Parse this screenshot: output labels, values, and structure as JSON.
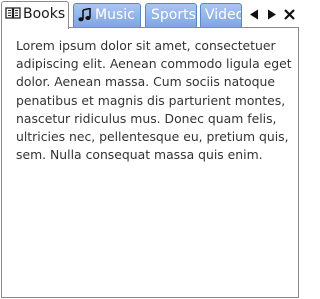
{
  "tabs": [
    {
      "label": "Books",
      "icon": "book-icon",
      "active": true
    },
    {
      "label": "Music",
      "icon": "music-note-icon",
      "active": false
    },
    {
      "label": "Sports",
      "active": false
    },
    {
      "label": "Video",
      "active": false
    }
  ],
  "nav": {
    "prev_icon": "triangle-left-icon",
    "next_icon": "triangle-right-icon",
    "close_icon": "close-icon"
  },
  "panel": {
    "text": "Lorem ipsum dolor sit amet, consectetuer adipiscing elit. Aenean commodo ligula eget dolor. Aenean massa. Cum sociis natoque penatibus et magnis dis parturient montes, nascetur ridiculus mus. Donec quam felis, ultricies nec, pellentesque eu, pretium quis, sem. Nulla consequat massa quis enim."
  },
  "colors": {
    "tab_inactive_top": "#a9c6f0",
    "tab_inactive_bottom": "#7fa6e2",
    "tab_border": "#5b87c8",
    "panel_border": "#8a8a8a",
    "text": "#333333"
  }
}
